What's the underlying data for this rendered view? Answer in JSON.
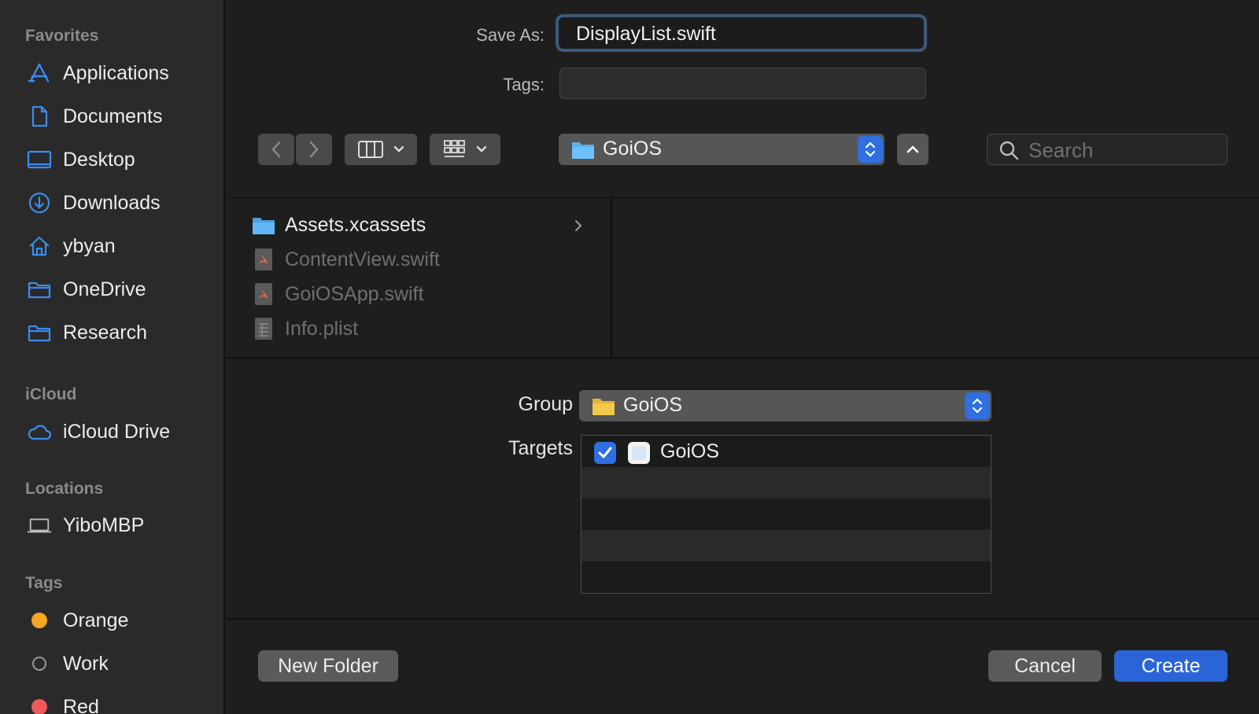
{
  "sidebar": {
    "favorites_title": "Favorites",
    "favorites": [
      {
        "label": "Applications",
        "icon": "applications-icon"
      },
      {
        "label": "Documents",
        "icon": "document-icon"
      },
      {
        "label": "Desktop",
        "icon": "desktop-icon"
      },
      {
        "label": "Downloads",
        "icon": "download-icon"
      },
      {
        "label": "ybyan",
        "icon": "home-icon"
      },
      {
        "label": "OneDrive",
        "icon": "folder-icon"
      },
      {
        "label": "Research",
        "icon": "folder-icon"
      }
    ],
    "icloud_title": "iCloud",
    "icloud": [
      {
        "label": "iCloud Drive",
        "icon": "cloud-icon"
      }
    ],
    "locations_title": "Locations",
    "locations": [
      {
        "label": "YiboMBP",
        "icon": "laptop-icon"
      }
    ],
    "tags_title": "Tags",
    "tags": [
      {
        "label": "Orange",
        "color": "#f5a623"
      },
      {
        "label": "Work",
        "color": "none"
      },
      {
        "label": "Red",
        "color": "#ee5a5a"
      }
    ]
  },
  "form": {
    "save_as_label": "Save As:",
    "save_as_value": "DisplayList.swift",
    "tags_label": "Tags:",
    "tags_value": ""
  },
  "toolbar": {
    "location": "GoiOS",
    "search_placeholder": "Search"
  },
  "files": [
    {
      "name": "Assets.xcassets",
      "icon": "folder-icon",
      "enabled": true,
      "has_children": true
    },
    {
      "name": "ContentView.swift",
      "icon": "swift-file-icon",
      "enabled": false
    },
    {
      "name": "GoiOSApp.swift",
      "icon": "swift-file-icon",
      "enabled": false
    },
    {
      "name": "Info.plist",
      "icon": "plist-file-icon",
      "enabled": false
    }
  ],
  "options": {
    "group_label": "Group",
    "group_value": "GoiOS",
    "targets_label": "Targets",
    "targets": [
      {
        "name": "GoiOS",
        "checked": true
      }
    ]
  },
  "buttons": {
    "new_folder": "New Folder",
    "cancel": "Cancel",
    "create": "Create"
  },
  "colors": {
    "accent": "#2f6fe0",
    "sidebar_icon": "#3b8cf0",
    "folder_yellow": "#f4c84a"
  }
}
